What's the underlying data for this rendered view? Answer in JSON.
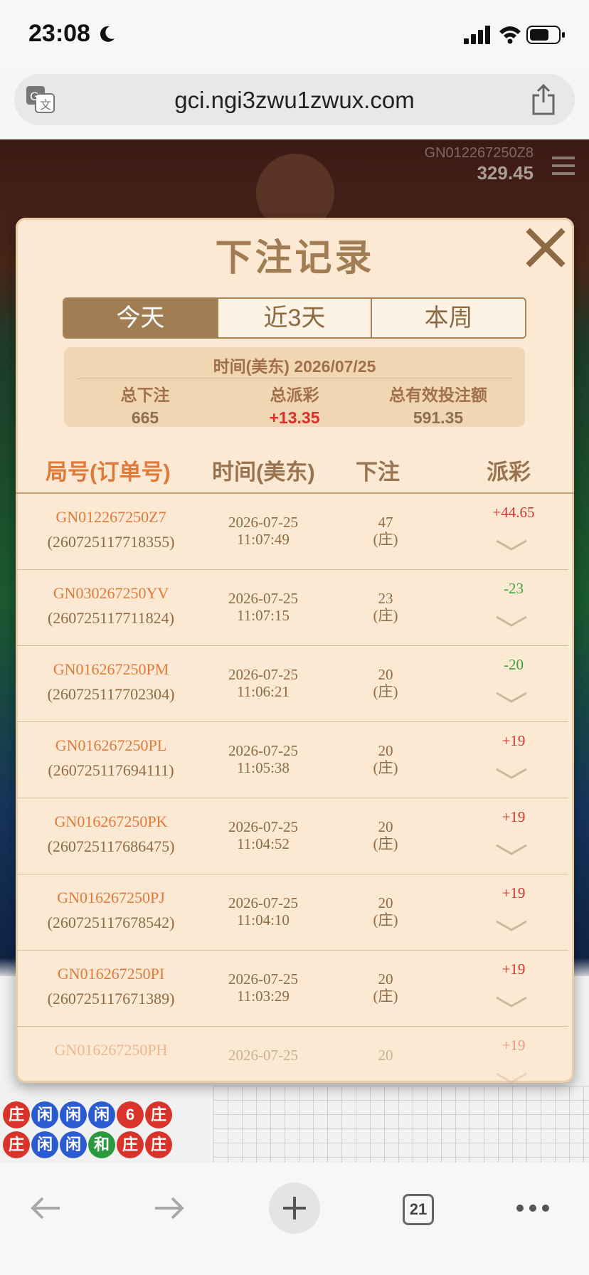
{
  "status_bar": {
    "time": "23:08",
    "icons": [
      "moon-icon",
      "signal-icon",
      "wifi-icon",
      "battery-icon"
    ]
  },
  "url_bar": {
    "url": "gci.ngi3zwu1zwux.com",
    "icons": [
      "translate-icon",
      "share-icon"
    ]
  },
  "game": {
    "table_code": "GN012267250Z8",
    "balance": "329.45",
    "road_beads": [
      "庄",
      "闲",
      "闲",
      "闲",
      "6",
      "庄",
      "庄",
      "闲",
      "闲",
      "和",
      "庄",
      "庄"
    ]
  },
  "modal": {
    "title": "下注记录",
    "close_icon": "close-icon",
    "tabs": [
      {
        "label": "今天",
        "active": true
      },
      {
        "label": "近3天",
        "active": false
      },
      {
        "label": "本周",
        "active": false
      }
    ],
    "summary": {
      "date_label": "时间(美东)  2026/07/25",
      "total_bet_label": "总下注",
      "total_bet": "665",
      "total_payout_label": "总派彩",
      "total_payout": "+13.35",
      "total_valid_label": "总有效投注额",
      "total_valid": "591.35"
    },
    "table": {
      "headers": [
        "局号(订单号)",
        "时间(美东)",
        "下注",
        "派彩"
      ],
      "rows": [
        {
          "id": "GN012267250Z7",
          "order": "(260725117718355)",
          "date": "2026-07-25",
          "time": "11:07:49",
          "bet": "47",
          "side": "(庄)",
          "payout": "+44.65",
          "positive": true
        },
        {
          "id": "GN030267250YV",
          "order": "(260725117711824)",
          "date": "2026-07-25",
          "time": "11:07:15",
          "bet": "23",
          "side": "(庄)",
          "payout": "-23",
          "positive": false
        },
        {
          "id": "GN016267250PM",
          "order": "(260725117702304)",
          "date": "2026-07-25",
          "time": "11:06:21",
          "bet": "20",
          "side": "(庄)",
          "payout": "-20",
          "positive": false
        },
        {
          "id": "GN016267250PL",
          "order": "(260725117694111)",
          "date": "2026-07-25",
          "time": "11:05:38",
          "bet": "20",
          "side": "(庄)",
          "payout": "+19",
          "positive": true
        },
        {
          "id": "GN016267250PK",
          "order": "(260725117686475)",
          "date": "2026-07-25",
          "time": "11:04:52",
          "bet": "20",
          "side": "(庄)",
          "payout": "+19",
          "positive": true
        },
        {
          "id": "GN016267250PJ",
          "order": "(260725117678542)",
          "date": "2026-07-25",
          "time": "11:04:10",
          "bet": "20",
          "side": "(庄)",
          "payout": "+19",
          "positive": true
        },
        {
          "id": "GN016267250PI",
          "order": "(260725117671389)",
          "date": "2026-07-25",
          "time": "11:03:29",
          "bet": "20",
          "side": "(庄)",
          "payout": "+19",
          "positive": true
        },
        {
          "id": "GN016267250PH",
          "order": "",
          "date": "2026-07-25",
          "time": "",
          "bet": "20",
          "side": "",
          "payout": "+19",
          "positive": true
        }
      ]
    }
  },
  "bottom_bar": {
    "tab_count": "21",
    "icons": [
      "back-icon",
      "forward-icon",
      "plus-icon",
      "more-icon"
    ]
  },
  "colors": {
    "modal_bg": "#fbe9d3",
    "accent_brown": "#a27c52",
    "id_orange": "#e07a3b",
    "positive_red": "#d8302a",
    "negative_green": "#3aa33b"
  }
}
